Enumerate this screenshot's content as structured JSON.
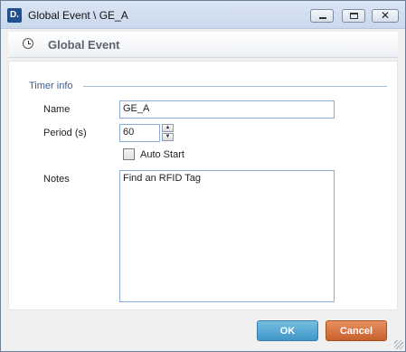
{
  "window": {
    "app_icon_text": "D.",
    "title": "Global Event \\ GE_A",
    "buttons": {
      "close_glyph": "✕"
    }
  },
  "header": {
    "title": "Global Event",
    "icon": "clock-icon"
  },
  "section": {
    "label": "Timer info"
  },
  "form": {
    "name_label": "Name",
    "name_value": "GE_A",
    "period_label": "Period (s)",
    "period_value": "60",
    "spin_up": "▲",
    "spin_down": "▼",
    "auto_start_label": "Auto Start",
    "auto_start_checked": false,
    "notes_label": "Notes",
    "notes_value": "Find an RFID Tag"
  },
  "footer": {
    "ok_label": "OK",
    "cancel_label": "Cancel"
  },
  "colors": {
    "ok": "#4aa3d4",
    "cancel": "#d2703e",
    "section": "#3d5f8c"
  }
}
